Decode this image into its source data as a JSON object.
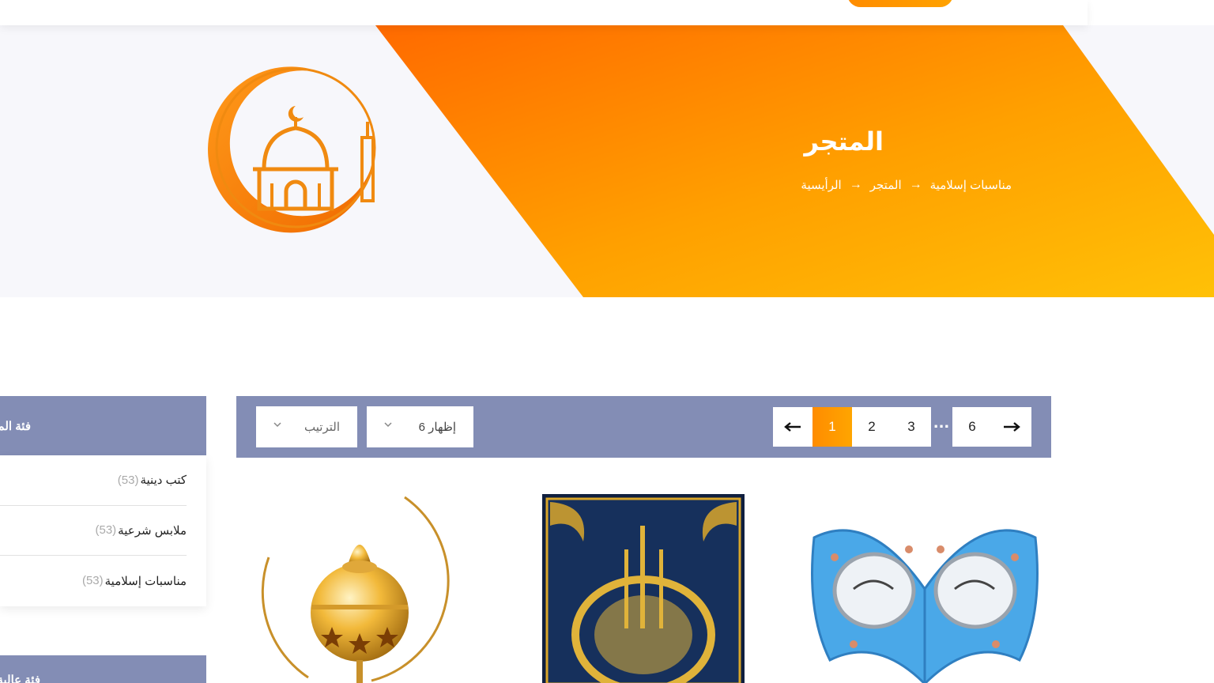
{
  "colors": {
    "accent": "#ff8c00",
    "accent_light": "#ffb703",
    "toolbar_bg": "#838db5",
    "hero_bg": "#f7f7fb"
  },
  "hero": {
    "title": "المتجر",
    "breadcrumb": [
      "مناسبات إسلامية",
      "المتجر",
      "الرأيسية"
    ],
    "breadcrumb_separator_icon": "arrow-left-icon",
    "logo_icon": "mosque-crescent-logo-icon"
  },
  "sidebar": {
    "heading": "فئة المنتجات",
    "items": [
      {
        "label": "كتب دينية",
        "count": "(53)"
      },
      {
        "label": "ملابس شرعية",
        "count": "(53)"
      },
      {
        "label": "مناسبات إسلامية",
        "count": "(53)"
      }
    ],
    "heading2": "فئة عالية التقييم"
  },
  "toolbar": {
    "sort_placeholder": "الترتيب",
    "show_label": "إظهار 6",
    "pages": [
      "1",
      "2",
      "3",
      "6"
    ],
    "active_page": "1",
    "ellipsis": "...",
    "prev_icon": "arrow-left-icon",
    "next_icon": "arrow-right-icon"
  },
  "products": [
    {
      "image_icon": "golden-incense-burner-icon"
    },
    {
      "image_icon": "ayat-al-kursi-calligraphy-frame-icon"
    },
    {
      "image_icon": "quran-stand-rehal-icon"
    }
  ]
}
